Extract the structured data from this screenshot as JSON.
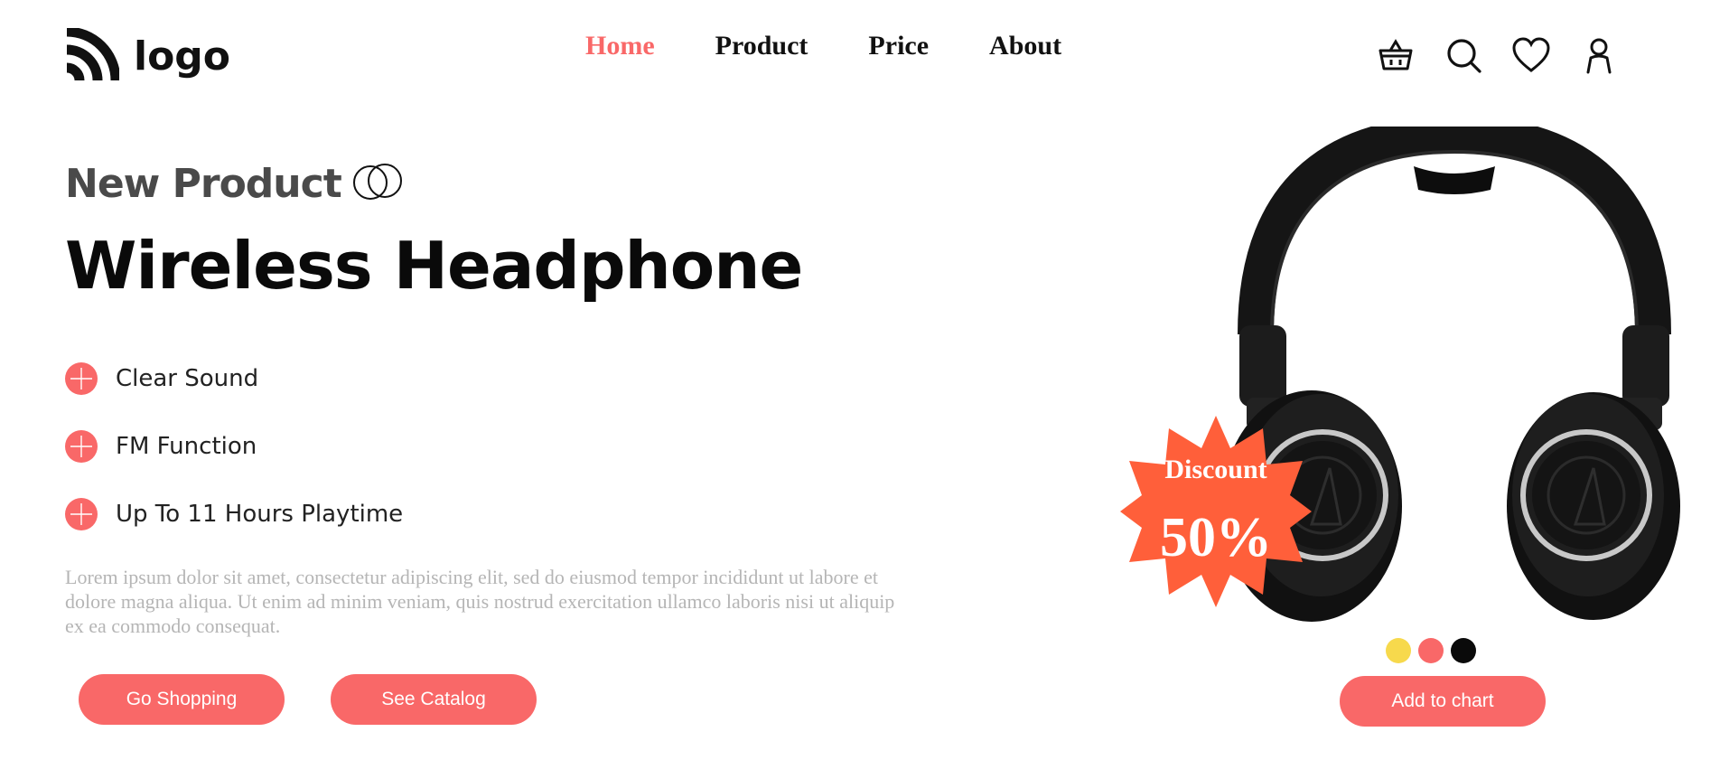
{
  "header": {
    "logo_text": "logo",
    "logo_icon": "wifi-waves-logo-icon",
    "nav": [
      {
        "label": "Home",
        "active": true
      },
      {
        "label": "Product",
        "active": false
      },
      {
        "label": "Price",
        "active": false
      },
      {
        "label": "About",
        "active": false
      }
    ],
    "icons": [
      "basket-icon",
      "search-icon",
      "heart-icon",
      "user-icon"
    ]
  },
  "hero": {
    "eyebrow": "New Product",
    "eyebrow_icon": "interlocking-rings-icon",
    "headline": "Wireless Headphone",
    "features": [
      {
        "label": "Clear Sound",
        "icon": "plus-circle-icon"
      },
      {
        "label": "FM Function",
        "icon": "plus-circle-icon"
      },
      {
        "label": "Up To 11 Hours Playtime",
        "icon": "plus-circle-icon"
      }
    ],
    "description": "Lorem ipsum dolor sit amet, consectetur adipiscing elit, sed do eiusmod tempor incididunt ut labore et dolore magna aliqua. Ut enim ad minim veniam, quis nostrud exercitation ullamco laboris nisi ut aliquip ex ea commodo consequat.",
    "buttons": {
      "primary": "Go Shopping",
      "secondary": "See Catalog"
    }
  },
  "product": {
    "image": "headphone-image",
    "discount_label": "Discount",
    "discount_value": "50%",
    "color_options": [
      "#f7d94c",
      "#f96868",
      "#0a0a0a"
    ],
    "cart_button": "Add to chart"
  },
  "colors": {
    "accent": "#f96868",
    "badge": "#ff5f3a",
    "text_dark": "#0a0a0a",
    "text_muted": "#b5b5b5"
  }
}
